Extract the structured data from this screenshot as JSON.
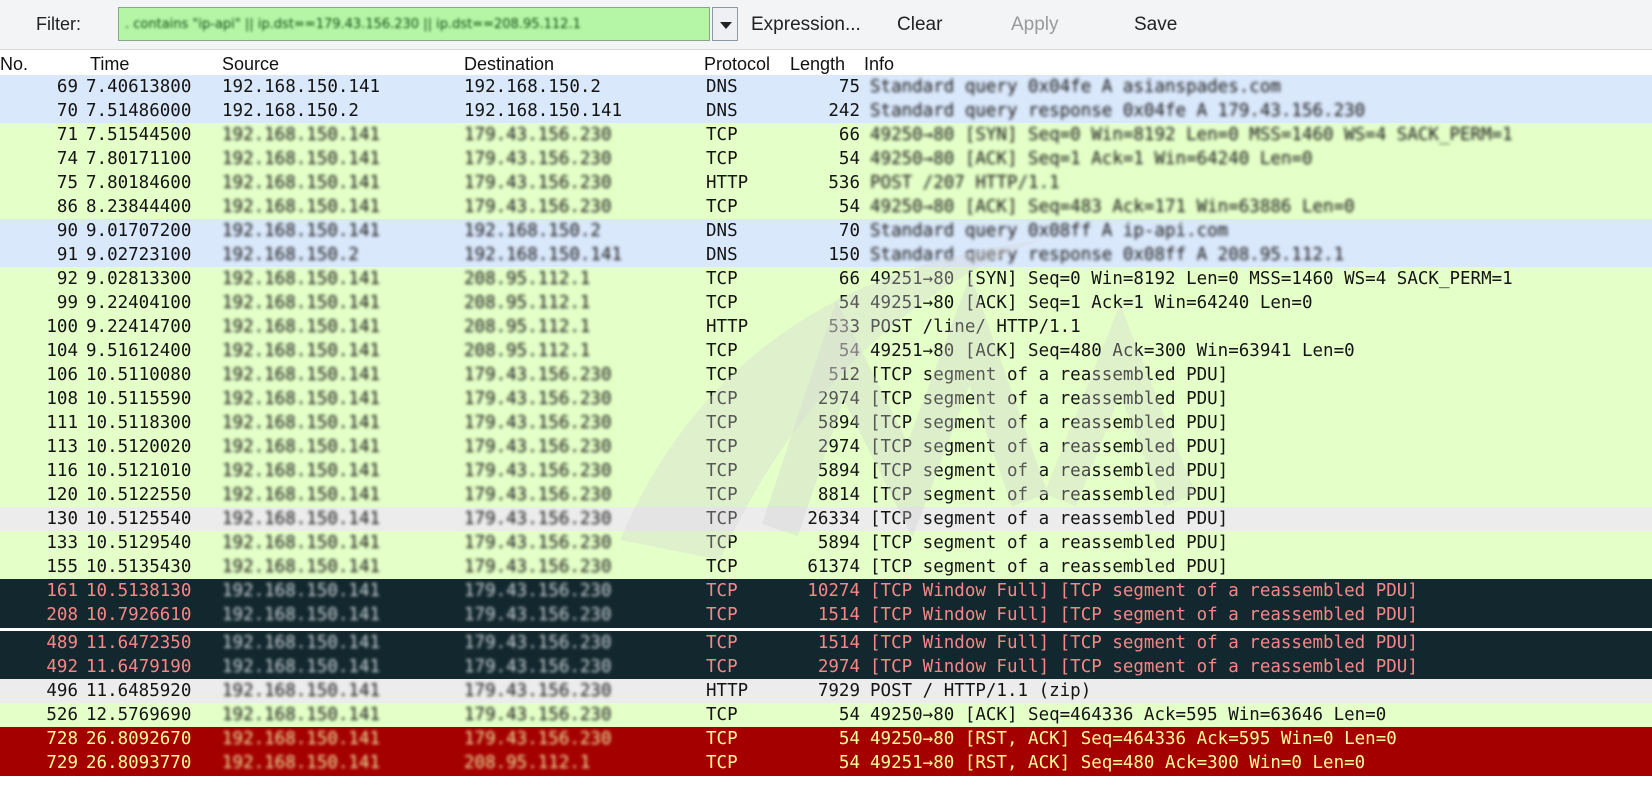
{
  "toolbar": {
    "filter_label": "Filter:",
    "filter_value": ". contains \"ip-api\" || ip.dst==179.43.156.230 || ip.dst==208.95.112.1",
    "expression_label": "Expression...",
    "clear_label": "Clear",
    "apply_label": "Apply",
    "save_label": "Save"
  },
  "columns": {
    "no": "No.",
    "time": "Time",
    "source": "Source",
    "destination": "Destination",
    "protocol": "Protocol",
    "length": "Length",
    "info": "Info"
  },
  "colors": {
    "udp_row": "#dae8fc",
    "tcp_row": "#e4ffc7",
    "window_full_row": "#12272e",
    "rst_row": "#a40000",
    "filter_valid": "#b4f5a6"
  },
  "packets": [
    {
      "no": "69",
      "time": "7.40613800",
      "src": "192.168.150.141",
      "dst": "192.168.150.2",
      "proto": "DNS",
      "len": "75",
      "info": "Standard query 0x04fe  A asianspades.com",
      "style": "udp",
      "blur_src": false,
      "blur_dst": false,
      "blur_info": true
    },
    {
      "no": "70",
      "time": "7.51486000",
      "src": "192.168.150.2",
      "dst": "192.168.150.141",
      "proto": "DNS",
      "len": "242",
      "info": "Standard query response 0x04fe  A 179.43.156.230",
      "style": "udp",
      "blur_src": false,
      "blur_dst": false,
      "blur_info": true
    },
    {
      "no": "71",
      "time": "7.51544500",
      "src": "192.168.150.141",
      "dst": "179.43.156.230",
      "proto": "TCP",
      "len": "66",
      "info": "49250→80 [SYN] Seq=0 Win=8192 Len=0 MSS=1460 WS=4 SACK_PERM=1",
      "style": "tcp",
      "blur_src": true,
      "blur_dst": true,
      "blur_info": true
    },
    {
      "no": "74",
      "time": "7.80171100",
      "src": "192.168.150.141",
      "dst": "179.43.156.230",
      "proto": "TCP",
      "len": "54",
      "info": "49250→80 [ACK] Seq=1 Ack=1 Win=64240 Len=0",
      "style": "tcp",
      "blur_src": true,
      "blur_dst": true,
      "blur_info": true
    },
    {
      "no": "75",
      "time": "7.80184600",
      "src": "192.168.150.141",
      "dst": "179.43.156.230",
      "proto": "HTTP",
      "len": "536",
      "info": "POST /207 HTTP/1.1",
      "style": "tcp",
      "blur_src": true,
      "blur_dst": true,
      "blur_info": true
    },
    {
      "no": "86",
      "time": "8.23844400",
      "src": "192.168.150.141",
      "dst": "179.43.156.230",
      "proto": "TCP",
      "len": "54",
      "info": "49250→80 [ACK] Seq=483 Ack=171 Win=63886 Len=0",
      "style": "tcp",
      "blur_src": true,
      "blur_dst": true,
      "blur_info": true
    },
    {
      "no": "90",
      "time": "9.01707200",
      "src": "192.168.150.141",
      "dst": "192.168.150.2",
      "proto": "DNS",
      "len": "70",
      "info": "Standard query 0x08ff  A ip-api.com",
      "style": "udp",
      "blur_src": true,
      "blur_dst": true,
      "blur_info": true
    },
    {
      "no": "91",
      "time": "9.02723100",
      "src": "192.168.150.2",
      "dst": "192.168.150.141",
      "proto": "DNS",
      "len": "150",
      "info": "Standard query response 0x08ff  A 208.95.112.1",
      "style": "udp",
      "blur_src": true,
      "blur_dst": true,
      "blur_info": true
    },
    {
      "no": "92",
      "time": "9.02813300",
      "src": "192.168.150.141",
      "dst": "208.95.112.1",
      "proto": "TCP",
      "len": "66",
      "info": "49251→80 [SYN] Seq=0 Win=8192 Len=0 MSS=1460 WS=4 SACK_PERM=1",
      "style": "tcp",
      "blur_src": true,
      "blur_dst": true,
      "blur_info": false
    },
    {
      "no": "99",
      "time": "9.22404100",
      "src": "192.168.150.141",
      "dst": "208.95.112.1",
      "proto": "TCP",
      "len": "54",
      "info": "49251→80 [ACK] Seq=1 Ack=1 Win=64240 Len=0",
      "style": "tcp",
      "blur_src": true,
      "blur_dst": true,
      "blur_info": false
    },
    {
      "no": "100",
      "time": "9.22414700",
      "src": "192.168.150.141",
      "dst": "208.95.112.1",
      "proto": "HTTP",
      "len": "533",
      "info": "POST /line/ HTTP/1.1",
      "style": "tcp",
      "blur_src": true,
      "blur_dst": true,
      "blur_info": false
    },
    {
      "no": "104",
      "time": "9.51612400",
      "src": "192.168.150.141",
      "dst": "208.95.112.1",
      "proto": "TCP",
      "len": "54",
      "info": "49251→80 [ACK] Seq=480 Ack=300 Win=63941 Len=0",
      "style": "tcp",
      "blur_src": true,
      "blur_dst": true,
      "blur_info": false
    },
    {
      "no": "106",
      "time": "10.5110080",
      "src": "192.168.150.141",
      "dst": "179.43.156.230",
      "proto": "TCP",
      "len": "512",
      "info": "[TCP segment of a reassembled PDU]",
      "style": "tcp",
      "blur_src": true,
      "blur_dst": true,
      "blur_info": false
    },
    {
      "no": "108",
      "time": "10.5115590",
      "src": "192.168.150.141",
      "dst": "179.43.156.230",
      "proto": "TCP",
      "len": "2974",
      "info": "[TCP segment of a reassembled PDU]",
      "style": "tcp",
      "blur_src": true,
      "blur_dst": true,
      "blur_info": false
    },
    {
      "no": "111",
      "time": "10.5118300",
      "src": "192.168.150.141",
      "dst": "179.43.156.230",
      "proto": "TCP",
      "len": "5894",
      "info": "[TCP segment of a reassembled PDU]",
      "style": "tcp",
      "blur_src": true,
      "blur_dst": true,
      "blur_info": false
    },
    {
      "no": "113",
      "time": "10.5120020",
      "src": "192.168.150.141",
      "dst": "179.43.156.230",
      "proto": "TCP",
      "len": "2974",
      "info": "[TCP segment of a reassembled PDU]",
      "style": "tcp",
      "blur_src": true,
      "blur_dst": true,
      "blur_info": false
    },
    {
      "no": "116",
      "time": "10.5121010",
      "src": "192.168.150.141",
      "dst": "179.43.156.230",
      "proto": "TCP",
      "len": "5894",
      "info": "[TCP segment of a reassembled PDU]",
      "style": "tcp",
      "blur_src": true,
      "blur_dst": true,
      "blur_info": false
    },
    {
      "no": "120",
      "time": "10.5122550",
      "src": "192.168.150.141",
      "dst": "179.43.156.230",
      "proto": "TCP",
      "len": "8814",
      "info": "[TCP segment of a reassembled PDU]",
      "style": "tcp",
      "blur_src": true,
      "blur_dst": true,
      "blur_info": false
    },
    {
      "no": "130",
      "time": "10.5125540",
      "src": "192.168.150.141",
      "dst": "179.43.156.230",
      "proto": "TCP",
      "len": "26334",
      "info": "[TCP segment of a reassembled PDU]",
      "style": "plain",
      "blur_src": true,
      "blur_dst": true,
      "blur_info": false
    },
    {
      "no": "133",
      "time": "10.5129540",
      "src": "192.168.150.141",
      "dst": "179.43.156.230",
      "proto": "TCP",
      "len": "5894",
      "info": "[TCP segment of a reassembled PDU]",
      "style": "tcp",
      "blur_src": true,
      "blur_dst": true,
      "blur_info": false
    },
    {
      "no": "155",
      "time": "10.5135430",
      "src": "192.168.150.141",
      "dst": "179.43.156.230",
      "proto": "TCP",
      "len": "61374",
      "info": "[TCP segment of a reassembled PDU]",
      "style": "tcp",
      "blur_src": true,
      "blur_dst": true,
      "blur_info": false
    },
    {
      "no": "161",
      "time": "10.5138130",
      "src": "192.168.150.141",
      "dst": "179.43.156.230",
      "proto": "TCP",
      "len": "10274",
      "info": "[TCP Window Full] [TCP segment of a reassembled PDU]",
      "style": "dark",
      "blur_src": true,
      "blur_dst": true,
      "blur_info": false
    },
    {
      "no": "208",
      "time": "10.7926610",
      "src": "192.168.150.141",
      "dst": "179.43.156.230",
      "proto": "TCP",
      "len": "1514",
      "info": "[TCP Window Full] [TCP segment of a reassembled PDU]",
      "style": "dark",
      "blur_src": true,
      "blur_dst": true,
      "blur_info": false
    },
    {
      "no": "489",
      "time": "11.6472350",
      "src": "192.168.150.141",
      "dst": "179.43.156.230",
      "proto": "TCP",
      "len": "1514",
      "info": "[TCP Window Full] [TCP segment of a reassembled PDU]",
      "style": "dark",
      "blur_src": true,
      "blur_dst": true,
      "blur_info": false
    },
    {
      "no": "492",
      "time": "11.6479190",
      "src": "192.168.150.141",
      "dst": "179.43.156.230",
      "proto": "TCP",
      "len": "2974",
      "info": "[TCP Window Full] [TCP segment of a reassembled PDU]",
      "style": "dark",
      "blur_src": true,
      "blur_dst": true,
      "blur_info": false
    },
    {
      "no": "496",
      "time": "11.6485920",
      "src": "192.168.150.141",
      "dst": "179.43.156.230",
      "proto": "HTTP",
      "len": "7929",
      "info": "POST / HTTP/1.1  (zip)",
      "style": "plain",
      "blur_src": true,
      "blur_dst": true,
      "blur_info": false
    },
    {
      "no": "526",
      "time": "12.5769690",
      "src": "192.168.150.141",
      "dst": "179.43.156.230",
      "proto": "TCP",
      "len": "54",
      "info": "49250→80 [ACK] Seq=464336 Ack=595 Win=63646 Len=0",
      "style": "tcp",
      "blur_src": true,
      "blur_dst": true,
      "blur_info": false
    },
    {
      "no": "728",
      "time": "26.8092670",
      "src": "192.168.150.141",
      "dst": "179.43.156.230",
      "proto": "TCP",
      "len": "54",
      "info": "49250→80 [RST, ACK] Seq=464336 Ack=595 Win=0 Len=0",
      "style": "rst",
      "blur_src": true,
      "blur_dst": true,
      "blur_info": false
    },
    {
      "no": "729",
      "time": "26.8093770",
      "src": "192.168.150.141",
      "dst": "208.95.112.1",
      "proto": "TCP",
      "len": "54",
      "info": "49251→80 [RST, ACK] Seq=480 Ack=300 Win=0 Len=0",
      "style": "rst",
      "blur_src": true,
      "blur_dst": true,
      "blur_info": false
    }
  ]
}
